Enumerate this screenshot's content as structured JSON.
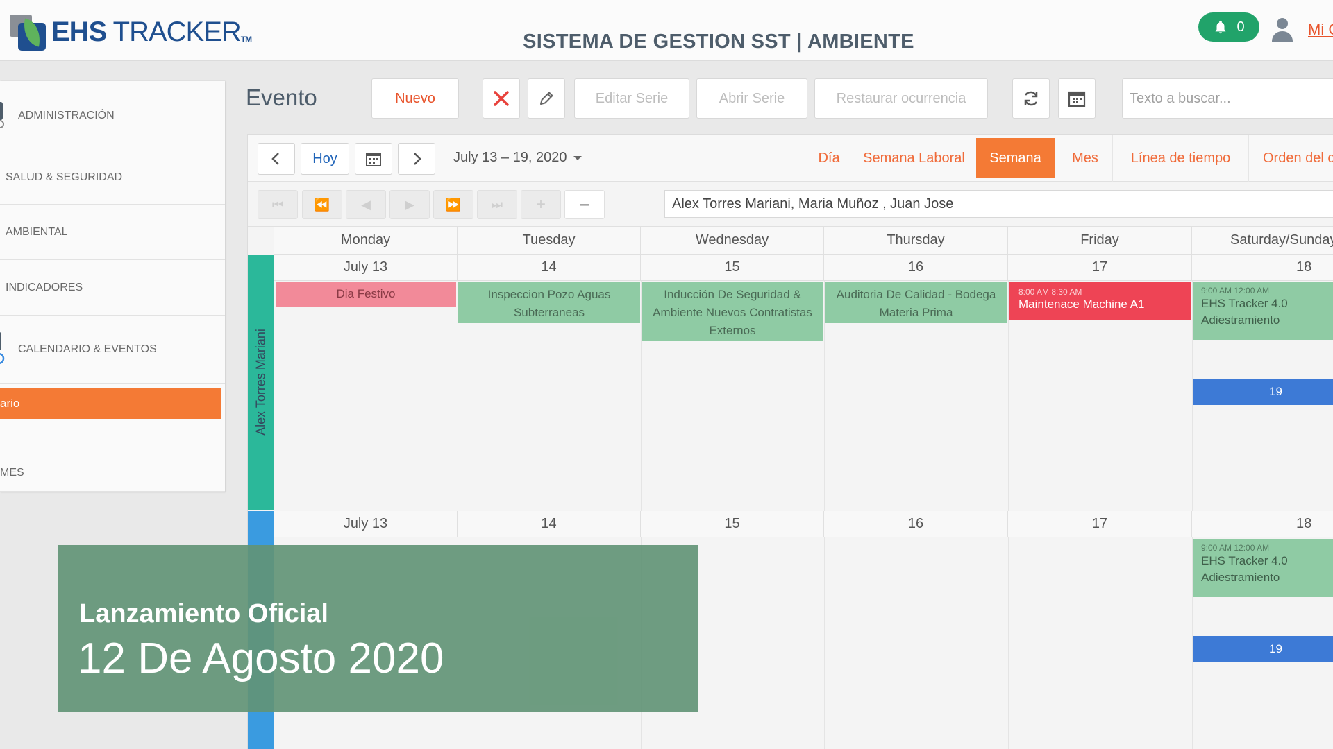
{
  "header": {
    "logo_bold": "EHS",
    "logo_light": " TRACKER",
    "logo_tm": "TM",
    "system_title": "SISTEMA DE GESTION SST | AMBIENTE",
    "notification_count": "0",
    "user_link": "Mi C"
  },
  "sidebar": {
    "items": [
      {
        "label": "ADMINISTRACIÓN"
      },
      {
        "label": "SALUD & SEGURIDAD"
      },
      {
        "label": "AMBIENTAL"
      },
      {
        "label": "INDICADORES"
      },
      {
        "label": "CALENDARIO & EVENTOS"
      }
    ],
    "active_item": "ario",
    "last_item": "MES"
  },
  "toolbar": {
    "title": "Evento",
    "new_label": "Nuevo",
    "edit_series_label": "Editar Serie",
    "open_series_label": "Abrir Serie",
    "restore_label": "Restaurar ocurrencia",
    "search_placeholder": "Texto a buscar..."
  },
  "navigation": {
    "today_label": "Hoy",
    "date_range": "July 13 – 19, 2020",
    "views": [
      {
        "label": "Día"
      },
      {
        "label": "Semana Laboral"
      },
      {
        "label": "Semana",
        "active": true
      },
      {
        "label": "Mes"
      },
      {
        "label": "Línea de tiempo"
      },
      {
        "label": "Orden del c"
      }
    ],
    "resources": "Alex Torres Mariani, Maria Muñoz , Juan Jose"
  },
  "calendar": {
    "day_headers": [
      "Monday",
      "Tuesday",
      "Wednesday",
      "Thursday",
      "Friday",
      "Saturday/Sunday"
    ],
    "dates": [
      "July 13",
      "14",
      "15",
      "16",
      "17",
      "18"
    ],
    "sunday_date": "19",
    "resource_1": "Alex Torres Mariani",
    "events_row1": {
      "monday": "Dia Festivo",
      "tuesday": "Inspeccion Pozo Aguas Subterraneas",
      "wednesday": "Inducción De Seguridad & Ambiente Nuevos Contratistas Externos",
      "thursday": "Auditoria De Calidad - Bodega Materia Prima",
      "friday_time": "8:00 AM 8:30 AM",
      "friday": "Maintenace Machine A1",
      "saturday_time": "9:00 AM 12:00 AM",
      "saturday": "EHS Tracker 4.0 Adiestramiento"
    },
    "events_row2": {
      "saturday_time": "9:00 AM 12:00 AM",
      "saturday": "EHS Tracker 4.0 Adiestramiento"
    },
    "colors": {
      "resource_1": "#2bb89a",
      "resource_2": "#3a9be0",
      "accent": "#f47a35"
    }
  },
  "overlay": {
    "title": "Lanzamiento Oficial",
    "date": "12 De Agosto 2020"
  }
}
